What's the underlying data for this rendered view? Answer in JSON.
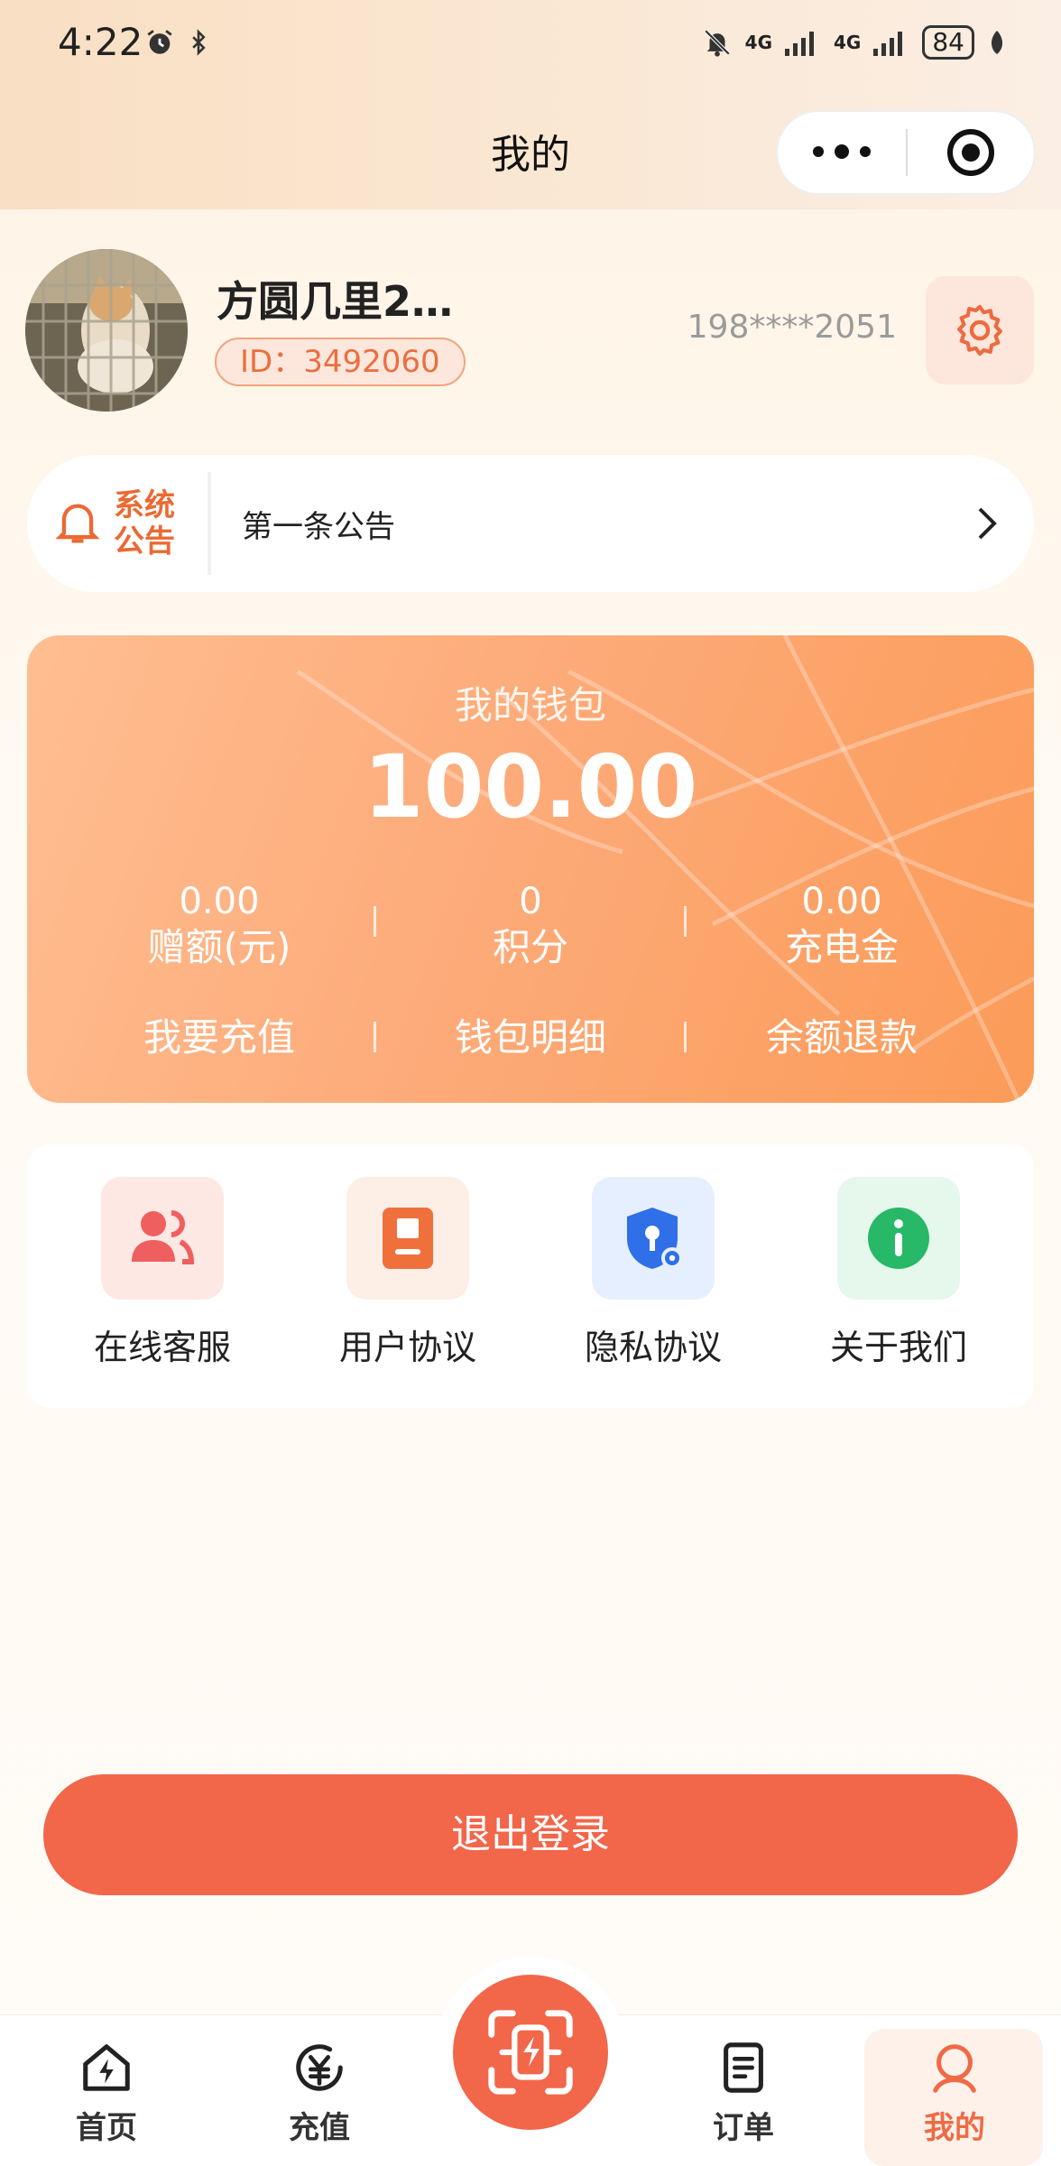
{
  "status_bar": {
    "time": "4:22",
    "battery": "84",
    "network_1": "4G",
    "network_2": "4G"
  },
  "header": {
    "title": "我的"
  },
  "profile": {
    "nickname": "方圆几里2…",
    "id": "ID：3492060",
    "phone": "198****2051"
  },
  "notice": {
    "label": "系统公告",
    "text": "第一条公告"
  },
  "wallet": {
    "title": "我的钱包",
    "balance": "100.00",
    "stats": [
      {
        "value": "0.00",
        "label": "赠额(元)"
      },
      {
        "value": "0",
        "label": "积分"
      },
      {
        "value": "0.00",
        "label": "充电金"
      }
    ],
    "actions": [
      "我要充值",
      "钱包明细",
      "余额退款"
    ]
  },
  "menu": {
    "items": [
      {
        "label": "在线客服",
        "icon": "customer-service-icon",
        "color": "#f05f5f"
      },
      {
        "label": "用户协议",
        "icon": "document-icon",
        "color": "#f0703c"
      },
      {
        "label": "隐私协议",
        "icon": "shield-lock-icon",
        "color": "#2f6fe8"
      },
      {
        "label": "关于我们",
        "icon": "info-icon",
        "color": "#27b868"
      }
    ]
  },
  "logout": {
    "label": "退出登录"
  },
  "tabbar": {
    "items": [
      {
        "label": "首页",
        "icon": "home-bolt-icon"
      },
      {
        "label": "充值",
        "icon": "recharge-icon"
      },
      {
        "label": "",
        "icon": "scan-charge-icon"
      },
      {
        "label": "订单",
        "icon": "order-icon"
      },
      {
        "label": "我的",
        "icon": "user-icon"
      }
    ],
    "active_index": 4
  },
  "colors": {
    "accent": "#f2664a",
    "notice": "#ea6a33",
    "wallet_start": "#ffbe91",
    "wallet_end": "#fb9b58"
  }
}
